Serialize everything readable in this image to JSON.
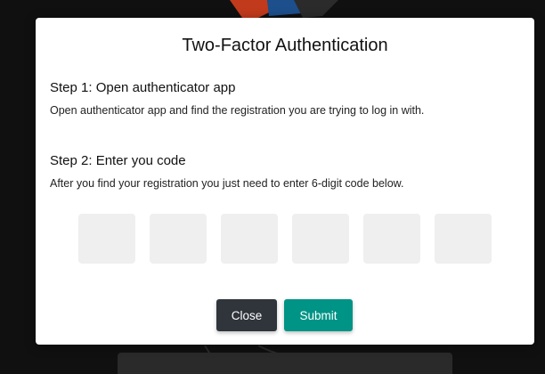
{
  "modal": {
    "title": "Two-Factor Authentication",
    "step1": {
      "heading": "Step 1: Open authenticator app",
      "description": "Open authenticator app and find the registration you are trying to log in with."
    },
    "step2": {
      "heading": "Step 2: Enter you code",
      "description": "After you find your registration you just need to enter 6-digit code below."
    },
    "code_digits": [
      "",
      "",
      "",
      "",
      "",
      ""
    ],
    "buttons": {
      "close_label": "Close",
      "submit_label": "Submit"
    }
  },
  "colors": {
    "backdrop": "#101010",
    "close_button": "#2f353b",
    "submit_button": "#009486",
    "code_box": "#efefef"
  }
}
